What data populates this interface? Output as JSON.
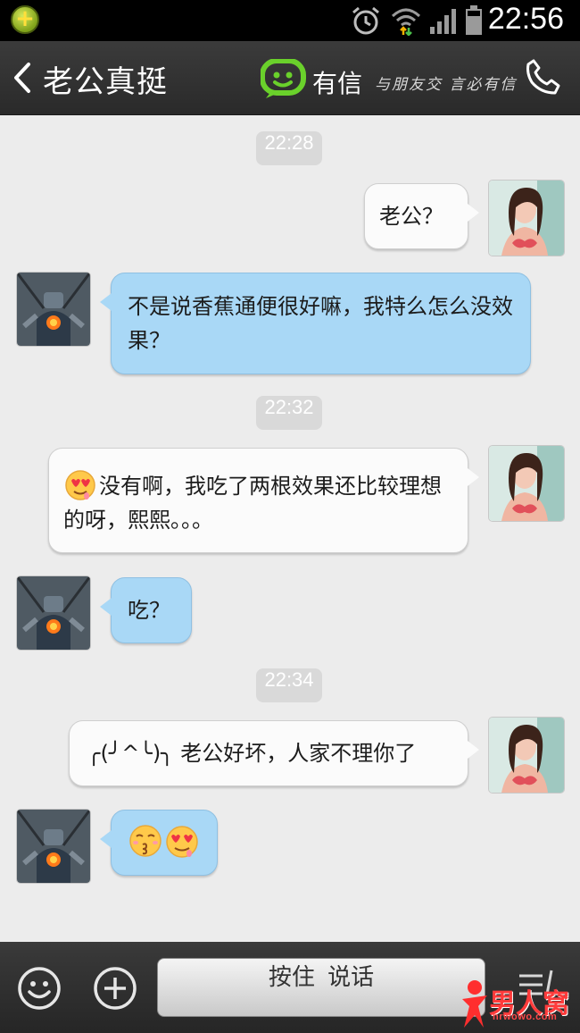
{
  "status_bar": {
    "time": "22:56",
    "icons": [
      "app-badge-icon",
      "alarm-icon",
      "wifi-icon",
      "signal-icon",
      "battery-icon"
    ]
  },
  "header": {
    "back_icon": "chevron-left-icon",
    "title": "老公真挺",
    "brand_name": "有信",
    "brand_slogan": "与朋友交 言必有信",
    "call_icon": "phone-icon",
    "brand_color": "#6ad12b"
  },
  "chat": {
    "timestamps": [
      "22:28",
      "22:32",
      "22:34"
    ],
    "messages": [
      {
        "from": "me",
        "text": "老公？"
      },
      {
        "from": "contact",
        "text": "不是说香蕉通便很好嘛，我特么怎么没效果？"
      },
      {
        "from": "me",
        "emoji": "heart-eyes-emoji",
        "text": "没有啊，我吃了两根效果还比较理想的呀，熙熙。。。"
      },
      {
        "from": "contact",
        "text": "吃？"
      },
      {
        "from": "me",
        "text": "╭(╯^╰)╮ 老公好坏，人家不理你了"
      },
      {
        "from": "contact",
        "emoji": [
          "kiss-emoji",
          "heart-eyes-emoji"
        ],
        "text": ""
      }
    ],
    "incoming_bubble_color": "#a9d8f6",
    "outgoing_bubble_color": "#fbfbfb"
  },
  "input_bar": {
    "emoji_icon": "smiley-icon",
    "add_icon": "plus-icon",
    "hold_to_talk": "按住 说话",
    "keyboard_icon": "keyboard-icon"
  },
  "watermark": {
    "text": "男人窝",
    "sub": "nrwowo.com"
  }
}
